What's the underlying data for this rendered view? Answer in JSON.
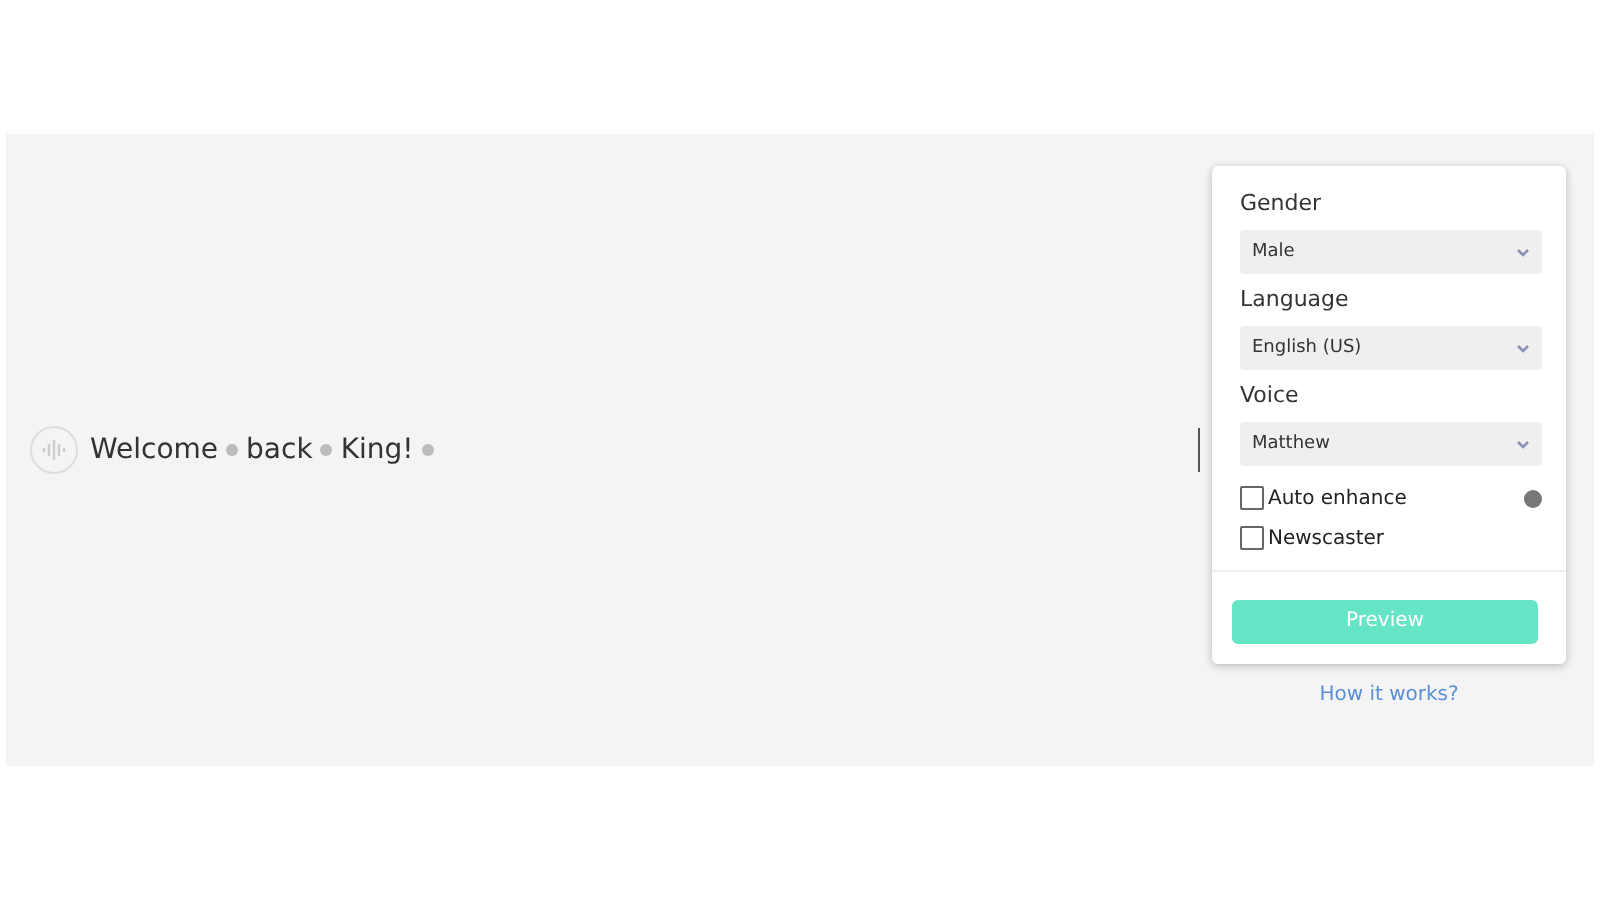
{
  "editor": {
    "words": [
      "Welcome",
      "back",
      "King!"
    ]
  },
  "settings": {
    "selects": [
      {
        "label": "Gender",
        "value": "Male"
      },
      {
        "label": "Language",
        "value": "English (US)"
      },
      {
        "label": "Voice",
        "value": "Matthew"
      }
    ],
    "options": [
      {
        "label": "Auto enhance",
        "checked": false,
        "info": true
      },
      {
        "label": "Newscaster",
        "checked": false,
        "info": false
      }
    ],
    "button": "Preview"
  },
  "help_link": "How it works?"
}
